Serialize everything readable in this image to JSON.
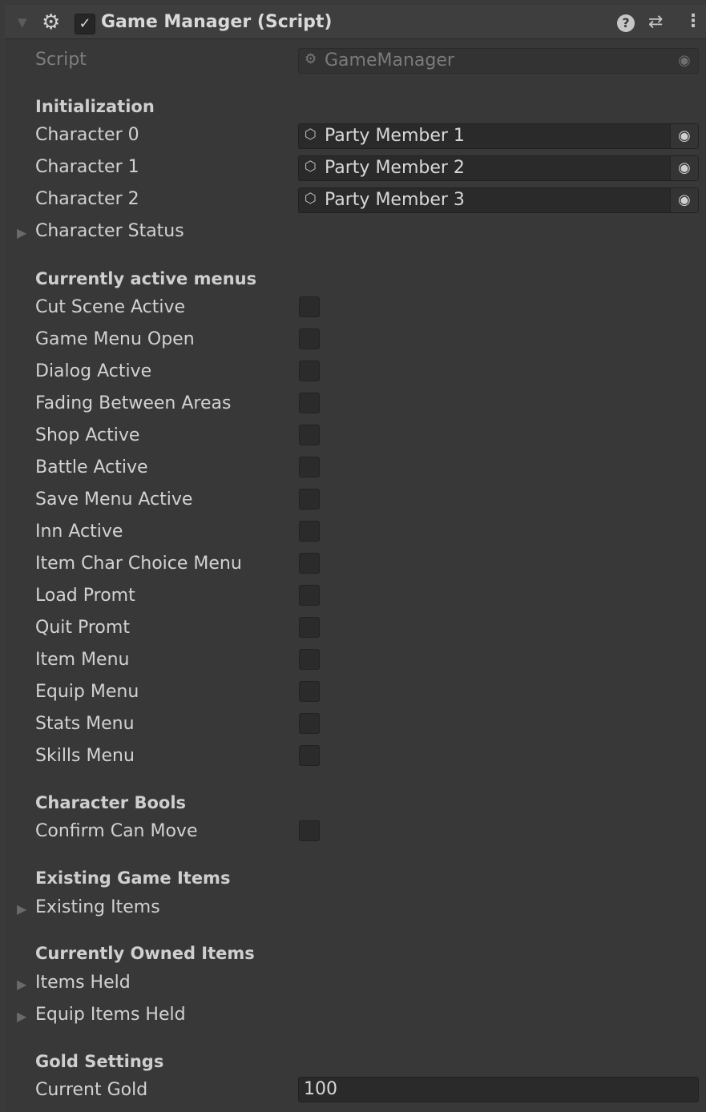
{
  "header": {
    "title": "Game Manager (Script)",
    "enabled_check": "✓",
    "icons": [
      "foldout-arrow-icon",
      "script-gear-icon",
      "help-icon",
      "preset-icon",
      "more-icon"
    ]
  },
  "script_field": {
    "label": "Script",
    "value": "GameManager"
  },
  "initialization": {
    "heading": "Initialization",
    "characters": [
      {
        "label": "Character 0",
        "value": "Party Member 1"
      },
      {
        "label": "Character 1",
        "value": "Party Member 2"
      },
      {
        "label": "Character 2",
        "value": "Party Member 3"
      }
    ],
    "character_status": "Character Status"
  },
  "menus": {
    "heading": "Currently active menus",
    "items": [
      {
        "label": "Cut Scene Active",
        "checked": false
      },
      {
        "label": "Game Menu Open",
        "checked": false
      },
      {
        "label": "Dialog Active",
        "checked": false
      },
      {
        "label": "Fading Between Areas",
        "checked": false
      },
      {
        "label": "Shop Active",
        "checked": false
      },
      {
        "label": "Battle Active",
        "checked": false
      },
      {
        "label": "Save Menu Active",
        "checked": false
      },
      {
        "label": "Inn Active",
        "checked": false
      },
      {
        "label": "Item Char Choice Menu",
        "checked": false
      },
      {
        "label": "Load Promt",
        "checked": false
      },
      {
        "label": "Quit Promt",
        "checked": false
      },
      {
        "label": "Item Menu",
        "checked": false
      },
      {
        "label": "Equip Menu",
        "checked": false
      },
      {
        "label": "Stats Menu",
        "checked": false
      },
      {
        "label": "Skills Menu",
        "checked": false
      }
    ]
  },
  "character_bools": {
    "heading": "Character Bools",
    "confirm_can_move": {
      "label": "Confirm Can Move",
      "checked": false
    }
  },
  "existing_game_items": {
    "heading": "Existing Game Items",
    "existing_items": "Existing Items"
  },
  "owned_items": {
    "heading": "Currently Owned Items",
    "items_held": "Items Held",
    "equip_items_held": "Equip Items Held"
  },
  "gold": {
    "heading": "Gold Settings",
    "label": "Current Gold",
    "value": "100"
  },
  "colors": {
    "background": "#383838",
    "field": "#2a2a2a",
    "text": "#d2d2d2",
    "disabled_text": "#7e7e7e"
  }
}
